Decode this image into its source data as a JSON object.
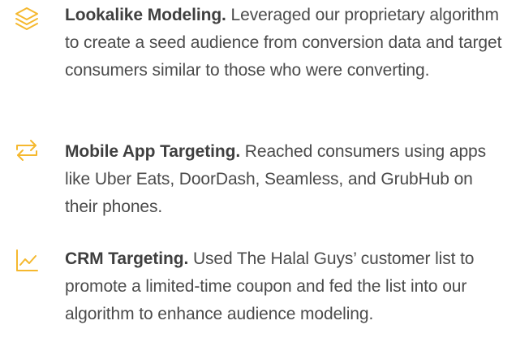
{
  "accent_color": "#F5B82E",
  "features": [
    {
      "icon": "layers-icon",
      "title": "Lookalike Modeling.",
      "body": " Leveraged our proprietary algorithm to create a seed audience from conversion data and target consumers similar to those who were converting."
    },
    {
      "icon": "swap-arrows-icon",
      "title": "Mobile App Targeting.",
      "body": " Reached consumers using apps like Uber Eats, DoorDash, Seamless, and GrubHub on their phones."
    },
    {
      "icon": "line-chart-icon",
      "title": "CRM Targeting.",
      "body": " Used The Halal Guys’ customer list to promote a limited-time coupon and fed the list into our algorithm to enhance audience modeling."
    }
  ]
}
